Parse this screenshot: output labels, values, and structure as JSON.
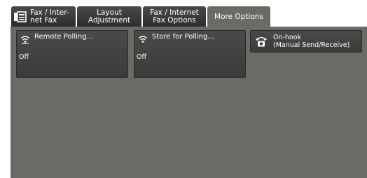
{
  "tabs": [
    {
      "label": "Fax / Inter-\nnet Fax",
      "icon": "fax-icon",
      "active": false
    },
    {
      "label": "Layout\nAdjustment",
      "active": false
    },
    {
      "label": "Fax / Internet\nFax Options",
      "active": false
    },
    {
      "label": "More Options",
      "active": true
    }
  ],
  "features": {
    "remote_polling": {
      "title": "Remote Polling...",
      "value": "Off",
      "icon": "wireless-signal-icon"
    },
    "store_for_polling": {
      "title": "Store for Polling...",
      "value": "Off",
      "icon": "wireless-signal-icon"
    },
    "on_hook": {
      "title": "On-hook\n(Manual Send/Receive)",
      "icon": "telephone-icon"
    }
  },
  "colors": {
    "tab_inactive": "#3a3a3a",
    "tab_active": "#6a6a66",
    "content_background": "#6a6a66",
    "tile_background": "#424240",
    "text": "#ffffff"
  }
}
